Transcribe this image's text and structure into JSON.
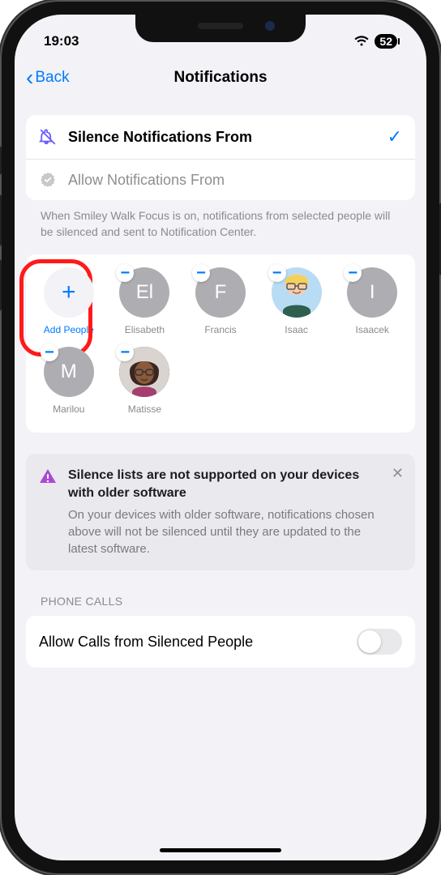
{
  "status": {
    "time": "19:03",
    "battery": "52"
  },
  "nav": {
    "back": "Back",
    "title": "Notifications"
  },
  "mode": {
    "silence_label": "Silence Notifications From",
    "allow_label": "Allow Notifications From",
    "description": "When Smiley Walk Focus is on, notifications from selected people will be silenced and sent to Notification Center."
  },
  "people": {
    "add_label": "Add People",
    "list": [
      {
        "name": "Elisabeth",
        "initials": "El"
      },
      {
        "name": "Francis",
        "initials": "F"
      },
      {
        "name": "Isaac",
        "initials": "",
        "variant": "isaac"
      },
      {
        "name": "Isaacek",
        "initials": "I"
      },
      {
        "name": "Marilou",
        "initials": "M"
      },
      {
        "name": "Matisse",
        "initials": "",
        "variant": "matisse"
      }
    ]
  },
  "alert": {
    "title": "Silence lists are not supported on your devices with older software",
    "body": "On your devices with older software, notifications chosen above will not be silenced until they are updated to the latest software."
  },
  "calls": {
    "header": "PHONE CALLS",
    "toggle_label": "Allow Calls from Silenced People",
    "toggle_on": false
  }
}
